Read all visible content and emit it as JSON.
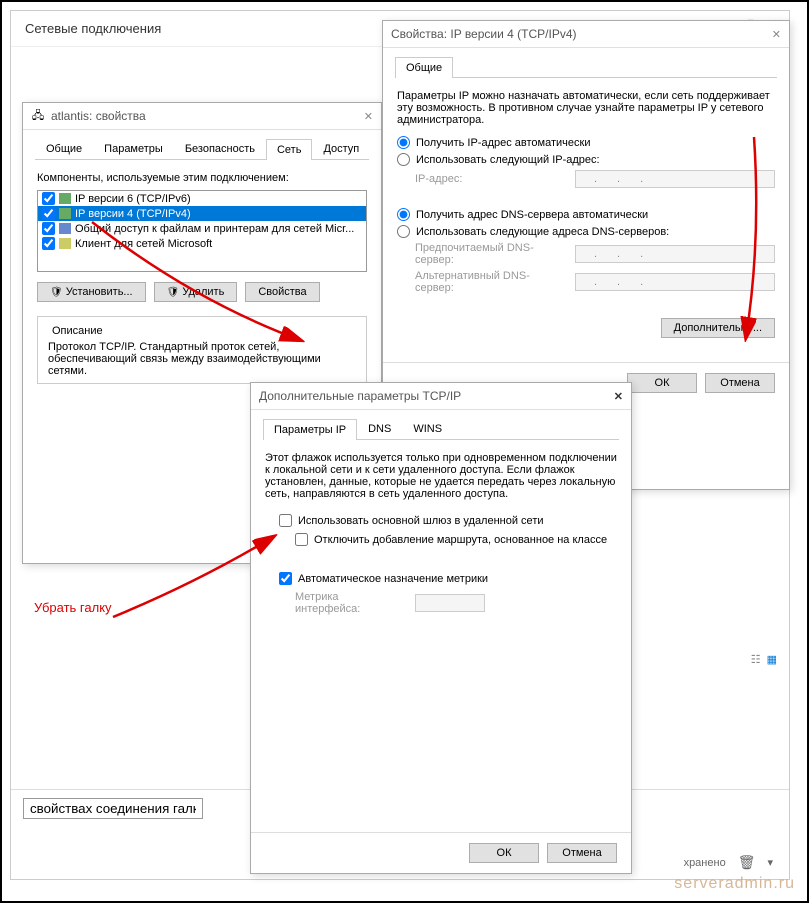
{
  "parent_window": {
    "title": "Сетевые подключения",
    "textbox_value": "свойствах соединения галку",
    "saved_label": "хранено",
    "trash_icon": "trash"
  },
  "properties_window": {
    "title": "atlantis: свойства",
    "tabs": [
      "Общие",
      "Параметры",
      "Безопасность",
      "Сеть",
      "Доступ"
    ],
    "active_tab": 3,
    "components_label": "Компоненты, используемые этим подключением:",
    "items": [
      {
        "label": "IP версии 6 (TCP/IPv6)",
        "checked": true
      },
      {
        "label": "IP версии 4 (TCP/IPv4)",
        "checked": true,
        "selected": true
      },
      {
        "label": "Общий доступ к файлам и принтерам для сетей Micr...",
        "checked": true
      },
      {
        "label": "Клиент для сетей Microsoft",
        "checked": true
      }
    ],
    "buttons": {
      "install": "Установить...",
      "remove": "Удалить",
      "props": "Свойства"
    },
    "description_title": "Описание",
    "description_text": "Протокол TCP/IP. Стандартный проток сетей, обеспечивающий связь между взаимодействующими сетями."
  },
  "ipv4_window": {
    "title": "Свойства: IP версии 4 (TCP/IPv4)",
    "tab": "Общие",
    "intro": "Параметры IP можно назначать автоматически, если сеть поддерживает эту возможность. В противном случае узнайте параметры IP у сетевого администратора.",
    "radio_auto_ip": "Получить IP-адрес автоматически",
    "radio_manual_ip": "Использовать следующий IP-адрес:",
    "ip_label": "IP-адрес:",
    "radio_auto_dns": "Получить адрес DNS-сервера автоматически",
    "radio_manual_dns": "Использовать следующие адреса DNS-серверов:",
    "dns_pref": "Предпочитаемый DNS-сервер:",
    "dns_alt": "Альтернативный DNS-сервер:",
    "advanced_btn": "Дополнительно...",
    "ok": "ОК",
    "cancel": "Отмена"
  },
  "advanced_window": {
    "title": "Дополнительные параметры TCP/IP",
    "tabs": [
      "Параметры IP",
      "DNS",
      "WINS"
    ],
    "intro": "Этот флажок используется только при одновременном подключении к локальной сети и к сети удаленного доступа. Если флажок установлен, данные, которые не удается передать через локальную сеть, направляются в сеть удаленного доступа.",
    "cb_gateway": "Использовать основной шлюз в удаленной сети",
    "cb_disable_route": "Отключить добавление маршрута, основанное на классе",
    "cb_auto_metric": "Автоматическое назначение метрики",
    "metric_label": "Метрика интерфейса:",
    "ok": "ОК",
    "cancel": "Отмена"
  },
  "annotation1": "Убрать галку",
  "watermark": "serveradmin.ru"
}
